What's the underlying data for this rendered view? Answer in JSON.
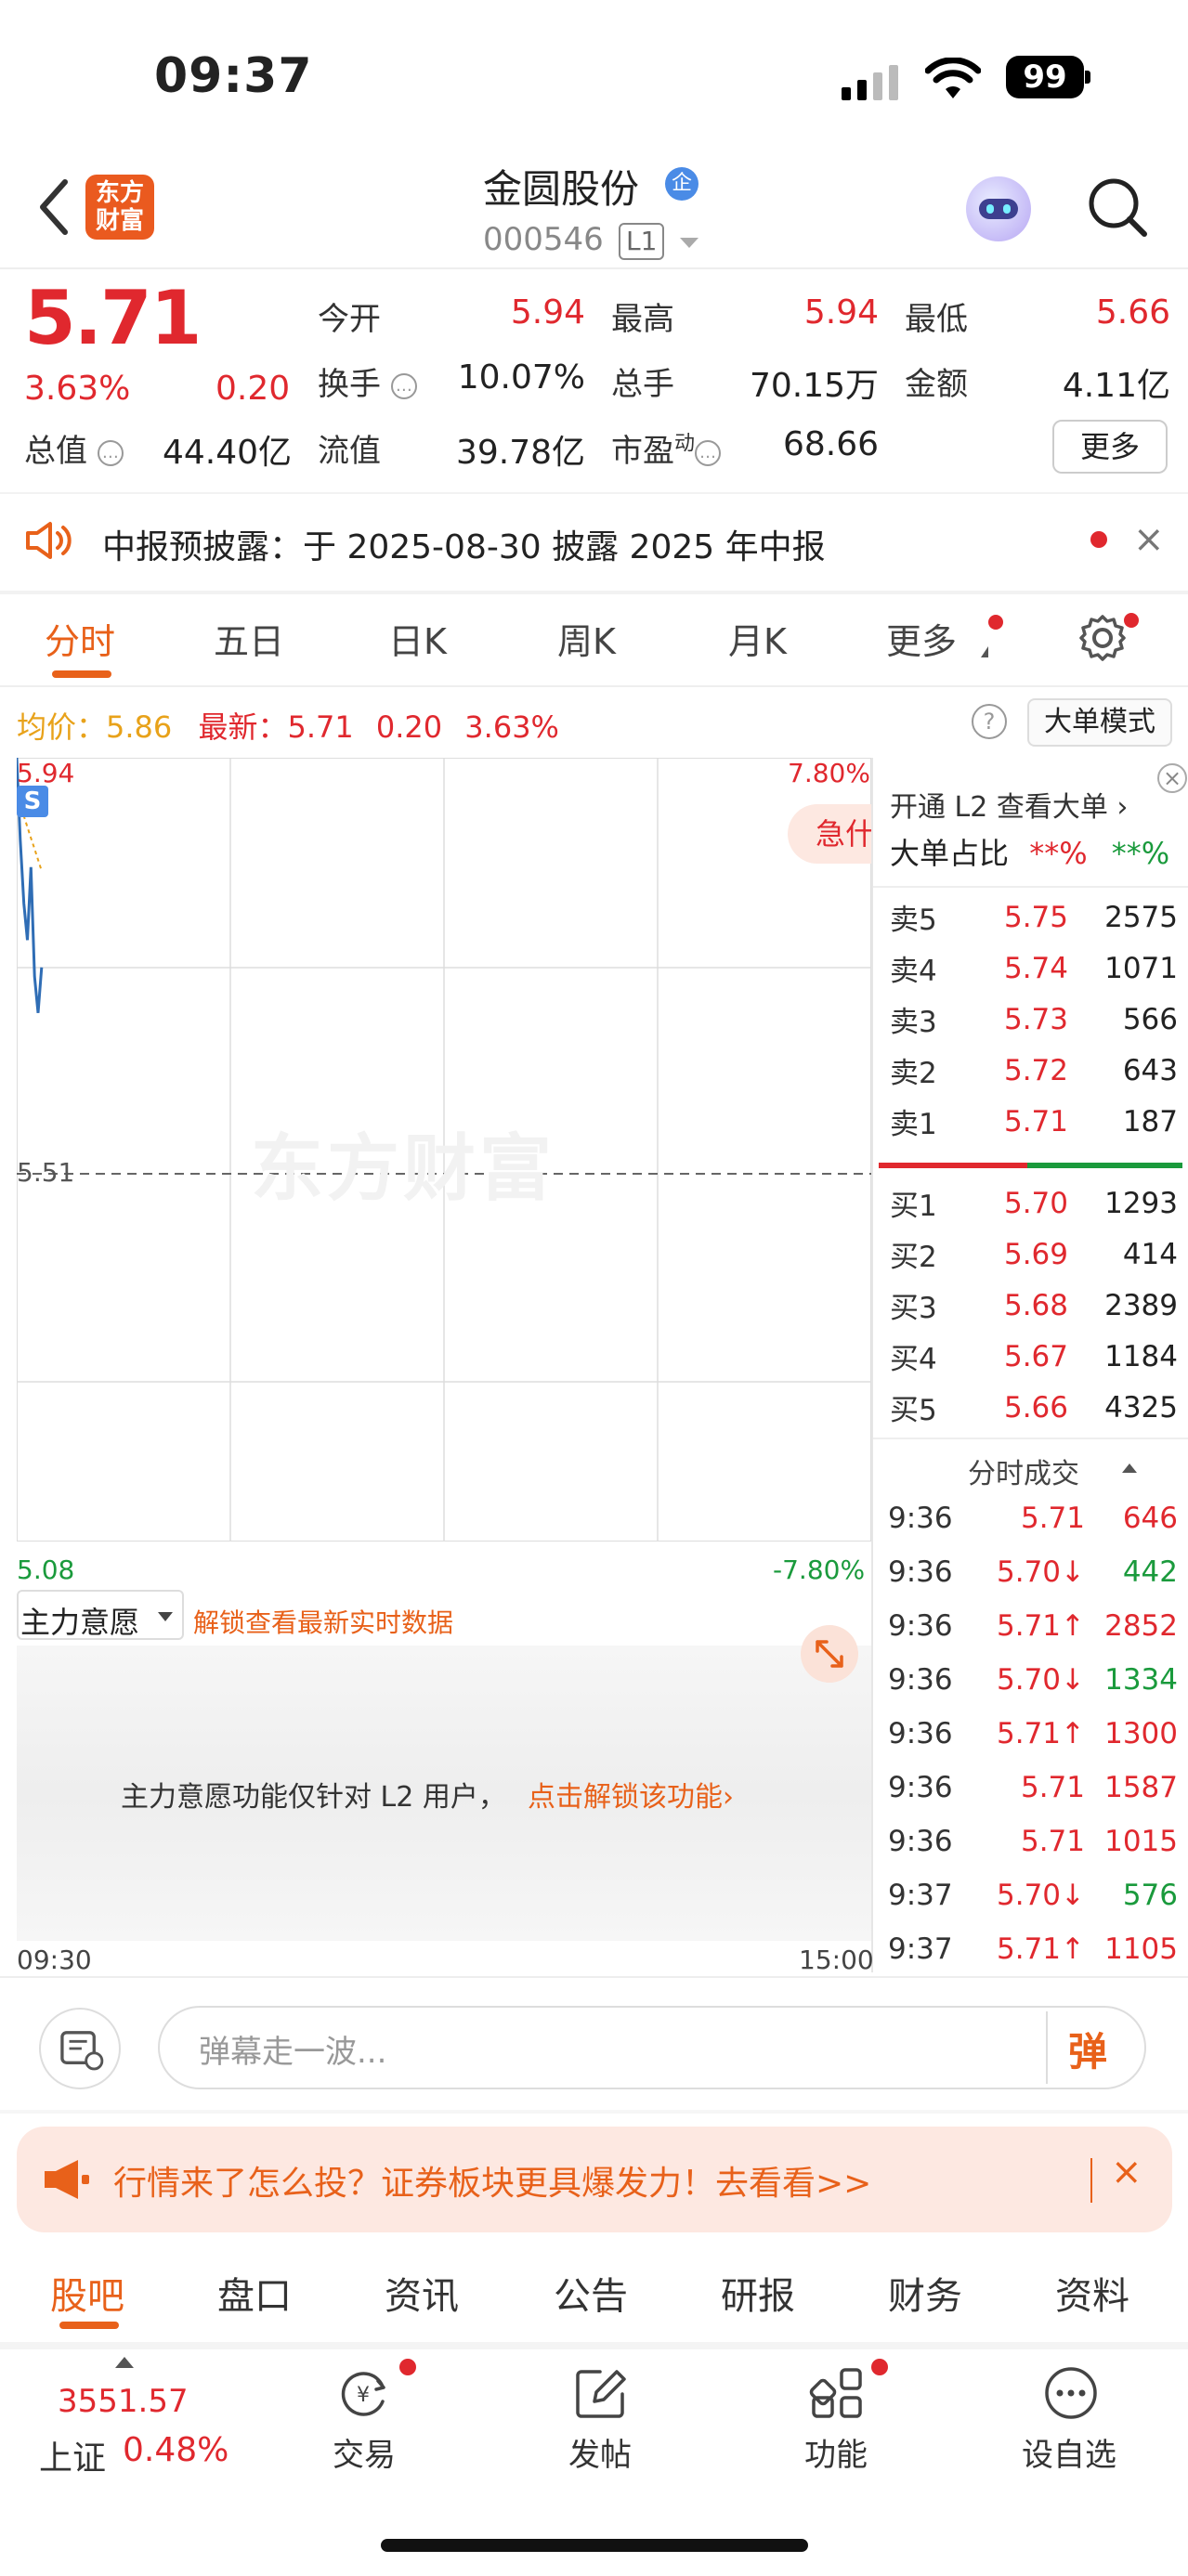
{
  "status_bar": {
    "time": "09:37",
    "battery": "99"
  },
  "header": {
    "logo": "东方\n财富",
    "name": "金圆股份",
    "name_badge": "企",
    "code": "000546",
    "level": "L1"
  },
  "quote": {
    "price": "5.71",
    "change_pct": "3.63%",
    "change": "0.20",
    "open_label": "今开",
    "open": "5.94",
    "high_label": "最高",
    "high": "5.94",
    "low_label": "最低",
    "low": "5.66",
    "turnover_label": "换手",
    "turnover": "10.07%",
    "volume_label": "总手",
    "volume": "70.15万",
    "amount_label": "金额",
    "amount": "4.11亿",
    "mcap_label": "总值",
    "mcap": "44.40亿",
    "float_label": "流值",
    "float_val": "39.78亿",
    "pe_label": "市盈",
    "pe_sup": "动",
    "pe": "68.66",
    "more": "更多"
  },
  "notice": {
    "text": "中报预披露：于 2025-08-30 披露 2025 年中报",
    "close": "×"
  },
  "chart_tabs": [
    "分时",
    "五日",
    "日K",
    "周K",
    "月K",
    "更多"
  ],
  "summary": {
    "avg_label": "均价：",
    "avg": "5.86",
    "last_label": "最新：",
    "last": "5.71",
    "chg": "0.20",
    "pct": "3.63%",
    "help": "?",
    "big_order_mode": "大单模式"
  },
  "chart": {
    "y_top": "5.94",
    "y_mid": "5.51",
    "y_bottom": "5.08",
    "pct_top": "7.80%",
    "pct_bottom": "-7.80%",
    "watermark": "东方财富",
    "marker": "S",
    "tag": "急什",
    "t_open": "09:30",
    "t_close": "15:00"
  },
  "chart_data": {
    "type": "line",
    "x": [
      "09:30",
      "09:31",
      "09:32",
      "09:33",
      "09:34",
      "09:35",
      "09:36",
      "09:37"
    ],
    "values": [
      5.94,
      5.85,
      5.78,
      5.74,
      5.82,
      5.7,
      5.66,
      5.71
    ],
    "ylim": [
      5.08,
      5.94
    ],
    "xlim": [
      "09:30",
      "15:00"
    ],
    "reference": 5.51
  },
  "orderbook": {
    "header": "开通 L2 查看大单 ›",
    "ratio_label": "大单占比",
    "ratio_red": "**%",
    "ratio_green": "**%",
    "asks": [
      {
        "label": "卖5",
        "price": "5.75",
        "vol": "2575"
      },
      {
        "label": "卖4",
        "price": "5.74",
        "vol": "1071"
      },
      {
        "label": "卖3",
        "price": "5.73",
        "vol": "566"
      },
      {
        "label": "卖2",
        "price": "5.72",
        "vol": "643"
      },
      {
        "label": "卖1",
        "price": "5.71",
        "vol": "187"
      }
    ],
    "bids": [
      {
        "label": "买1",
        "price": "5.70",
        "vol": "1293"
      },
      {
        "label": "买2",
        "price": "5.69",
        "vol": "414"
      },
      {
        "label": "买3",
        "price": "5.68",
        "vol": "2389"
      },
      {
        "label": "买4",
        "price": "5.67",
        "vol": "1184"
      },
      {
        "label": "买5",
        "price": "5.66",
        "vol": "4325"
      }
    ],
    "trades_header": "分时成交",
    "trades": [
      {
        "time": "9:36",
        "price": "5.71",
        "vol": "646",
        "dir": ""
      },
      {
        "time": "9:36",
        "price": "5.70↓",
        "vol": "442",
        "dir": "down"
      },
      {
        "time": "9:36",
        "price": "5.71↑",
        "vol": "2852",
        "dir": "up"
      },
      {
        "time": "9:36",
        "price": "5.70↓",
        "vol": "1334",
        "dir": "down"
      },
      {
        "time": "9:36",
        "price": "5.71↑",
        "vol": "1300",
        "dir": "up"
      },
      {
        "time": "9:36",
        "price": "5.71",
        "vol": "1587",
        "dir": ""
      },
      {
        "time": "9:36",
        "price": "5.71",
        "vol": "1015",
        "dir": ""
      },
      {
        "time": "9:37",
        "price": "5.70↓",
        "vol": "576",
        "dir": "down"
      },
      {
        "time": "9:37",
        "price": "5.71↑",
        "vol": "1105",
        "dir": "up"
      }
    ]
  },
  "main_force": {
    "label": "主力意愿",
    "unlock": "解锁查看最新实时数据",
    "text": "主力意愿功能仅针对 L2 用户，",
    "link": "点击解锁该功能›"
  },
  "danmaku": {
    "placeholder": "弹幕走一波...",
    "send": "弹"
  },
  "ad": {
    "text": "行情来了怎么投？证券板块更具爆发力！去看看>>",
    "close": "×"
  },
  "bottom_tabs": [
    "股吧",
    "盘口",
    "资讯",
    "公告",
    "研报",
    "财务",
    "资料"
  ],
  "nav": {
    "index_value": "3551.57",
    "index_label": "上证",
    "index_pct": "0.48%",
    "trade": "交易",
    "post": "发帖",
    "function": "功能",
    "watchlist": "设自选"
  },
  "colors": {
    "up": "#e0282e",
    "down": "#1a9a3c",
    "accent": "#e8611a",
    "line": "#2f6db5"
  }
}
